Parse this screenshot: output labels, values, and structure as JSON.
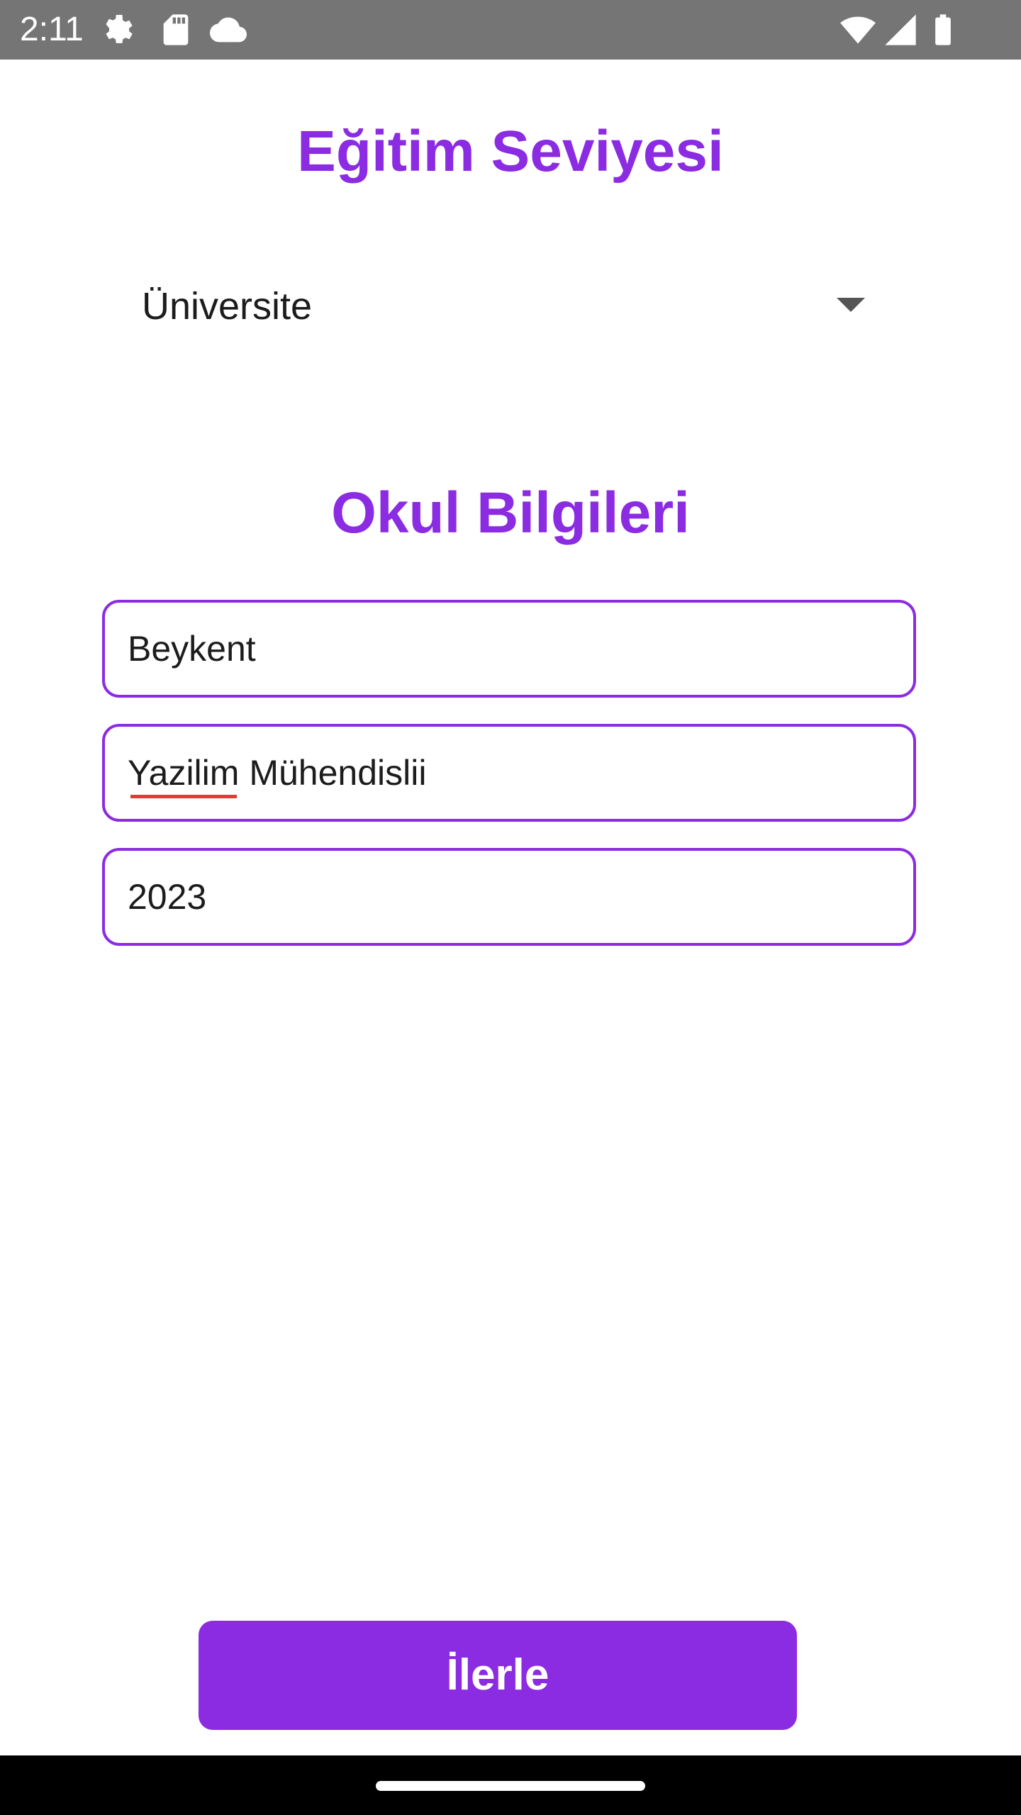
{
  "status_bar": {
    "time": "2:11",
    "icons": [
      "settings-icon",
      "sd-card-icon",
      "cloud-icon",
      "wifi-icon",
      "signal-icon",
      "battery-icon"
    ]
  },
  "education": {
    "title": "Eğitim Seviyesi",
    "selected_level": "Üniversite"
  },
  "school": {
    "title": "Okul Bilgileri",
    "fields": [
      {
        "name": "school-name",
        "value": "Beykent"
      },
      {
        "name": "department",
        "value": "Yazilim Mühendislii"
      },
      {
        "name": "graduation-year",
        "value": "2023"
      }
    ]
  },
  "actions": {
    "next_label": "İlerle"
  },
  "colors": {
    "accent": "#8B2BE2",
    "status_bar": "#757575",
    "spellcheck": "#E53935"
  }
}
